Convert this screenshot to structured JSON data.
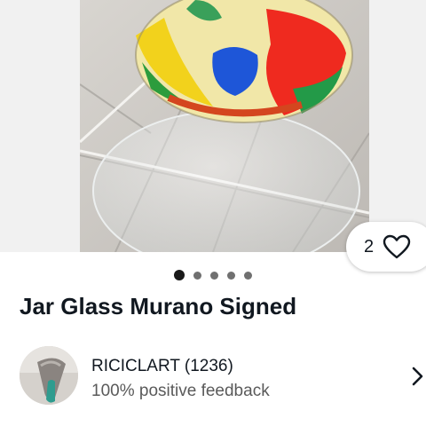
{
  "listing": {
    "title": "Jar Glass Murano Signed",
    "favorite_count": "2",
    "gallery": {
      "image_count": 5,
      "active_index": 0
    }
  },
  "seller": {
    "name_with_score": "RICICLART (1236)",
    "feedback": "100% positive feedback"
  },
  "icons": {
    "favorite": "heart-outline-icon",
    "seller_link": "chevron-right-icon"
  },
  "colors": {
    "text_primary": "#111820",
    "text_secondary": "#5a5a5a",
    "dot_active": "#191919",
    "dot_inactive": "#707070"
  }
}
